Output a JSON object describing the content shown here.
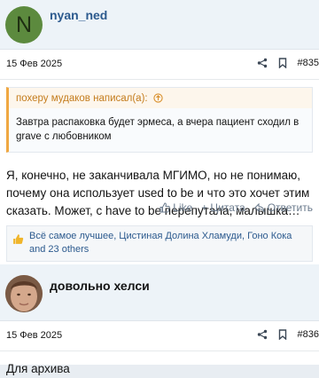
{
  "post1": {
    "author": "nyan_ned",
    "avatar_letter": "N",
    "date": "15 Фев 2025",
    "post_number": "#835",
    "quote": {
      "attribution": "похеру мудаков написал(а):",
      "text": "Завтра распаковка будет эрмеса, а вчера пациент сходил в grave с любовником"
    },
    "text": "Я, конечно, не заканчивала МГИМО, но не понимаю, почему она использует used to be и что это хочет этим сказать. Может, с have to be перепутала, малышка…",
    "actions": {
      "like": "Like",
      "quote": "Цитата",
      "reply": "Ответить"
    },
    "reactions": "Всё самое лучшее, Цистиная Долина Хламуди, Гоно Кока and 23 others"
  },
  "post2": {
    "author": "довольно хелси",
    "date": "15 Фев 2025",
    "post_number": "#836",
    "text": "Для архива"
  },
  "colors": {
    "accent": "#2c5a8e",
    "quote_bar": "#f0a842",
    "header_bg": "#edf3f8"
  },
  "icons": [
    "share-icon",
    "bookmark-icon",
    "arrow-up-circle-icon",
    "like-icon",
    "plus-icon",
    "reply-icon",
    "thumbs-up-icon"
  ]
}
